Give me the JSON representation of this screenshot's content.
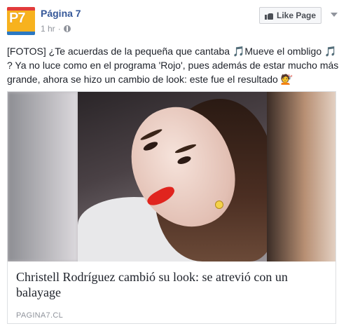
{
  "post": {
    "page_name": "Página 7",
    "avatar_text": "P7",
    "time": "1 hr",
    "separator": "·",
    "like_button": "Like Page",
    "text_parts": {
      "a": "[FOTOS] ¿Te acuerdas de la pequeña que cantaba ",
      "b": "Mueve el ombligo ",
      "c": "? Ya no luce como en el programa 'Rojo', pues además de estar mucho más grande, ahora se hizo un cambio de look: este fue el resultado "
    },
    "emoji": {
      "note": "🎵",
      "haircut": "💇"
    }
  },
  "link_card": {
    "title": "Christell Rodríguez cambió su look: se atrevió con un balayage",
    "source": "PAGINA7.CL"
  },
  "colors": {
    "link": "#365899",
    "meta": "#90949c",
    "avatar_bg": "#f7b21e",
    "lipstick": "#e0241e"
  }
}
